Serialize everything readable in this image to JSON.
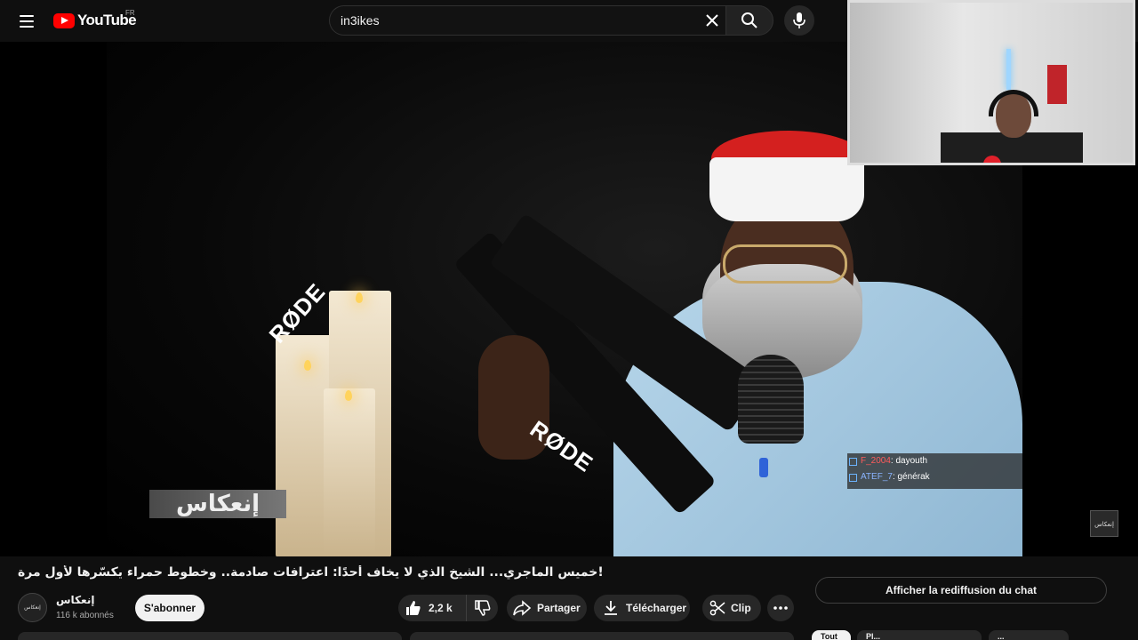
{
  "header": {
    "logo_text": "YouTube",
    "country": "FR",
    "search_value": "in3ikes"
  },
  "video": {
    "watermark": "إنعكاس",
    "corner_logo": "إنعكاس",
    "mic_brand": "RØDE",
    "title": "!خميس الماجري... الشيخ الذي لا يخاف أحدًا: اعترافات صادمة.. وخطوط حمراء يكسّرها لأول مرة"
  },
  "overlay_chat": [
    {
      "user": "F_2004",
      "message": ": dayouth",
      "color": "red"
    },
    {
      "user": "ATEF_7",
      "message": ": générak",
      "color": "blue"
    }
  ],
  "channel": {
    "name": "إنعكاس",
    "avatar_text": "إنعكاس",
    "subscribers": "116 k abonnés",
    "subscribe_label": "S'abonner"
  },
  "actions": {
    "likes": "2,2 k",
    "share": "Partager",
    "download": "Télécharger",
    "clip": "Clip"
  },
  "sidebar": {
    "chat_replay": "Afficher la rediffusion du chat",
    "chips": [
      "Tout",
      "Pl...",
      "..."
    ]
  },
  "colors": {
    "accent": "#ff0000",
    "background": "#0f0f0f",
    "pill": "#272727"
  }
}
